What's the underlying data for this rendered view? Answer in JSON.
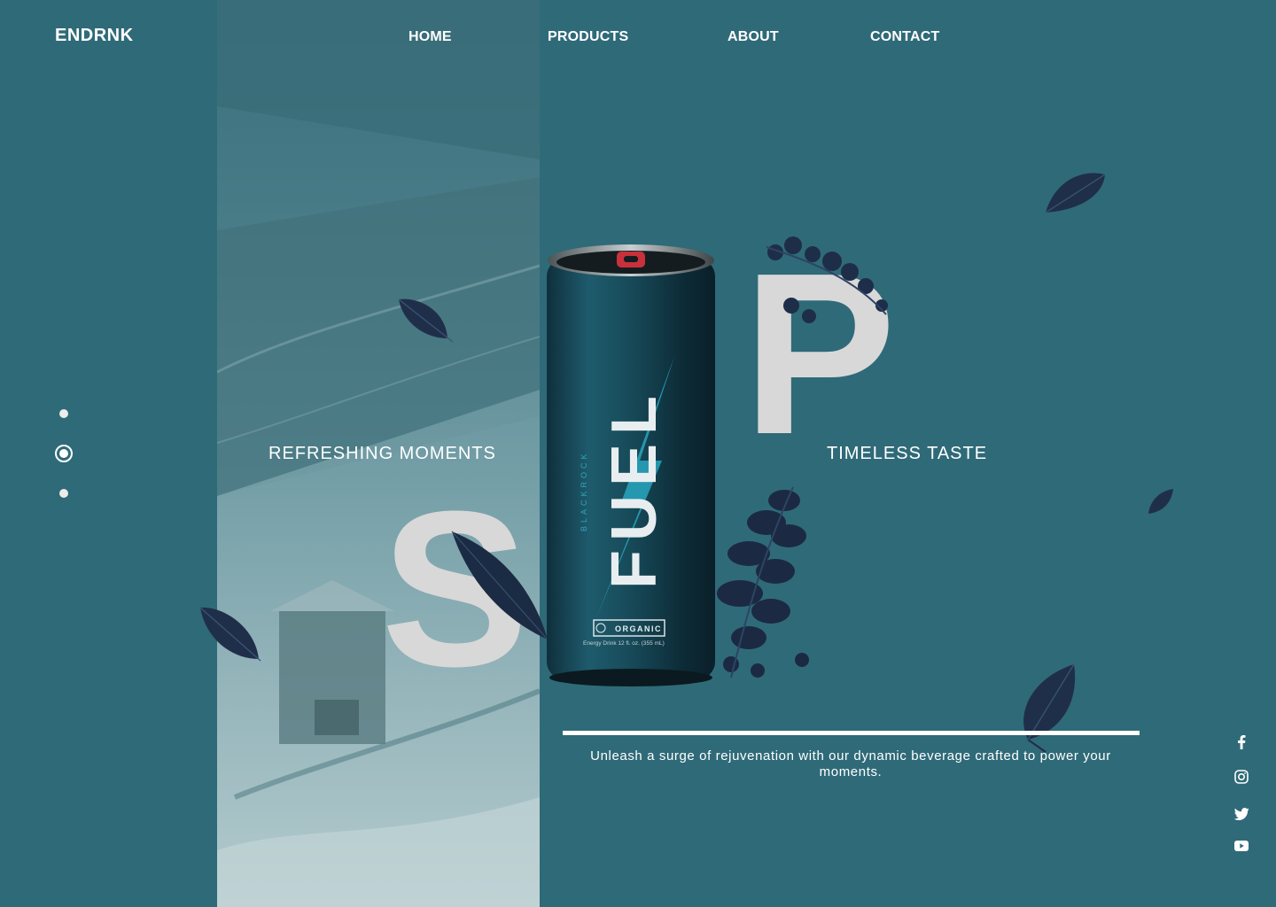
{
  "brand": {
    "logo": "ENDRNK"
  },
  "nav": {
    "items": [
      {
        "label": "HOME"
      },
      {
        "label": "PRODUCTS"
      },
      {
        "label": "ABOUT"
      },
      {
        "label": "CONTACT"
      }
    ]
  },
  "hero": {
    "tag_left": "REFRESHING MOMENTS",
    "tag_right": "TIMELESS TASTE",
    "letter_left": "S",
    "letter_right": "P",
    "can": {
      "brand_text": "FUEL",
      "sub_brand": "BLACKROCK",
      "badge": "ORGANIC",
      "caption": "Energy Drink    12 fl. oz. (355 mL)"
    },
    "description": "Unleash a surge of rejuvenation with our dynamic beverage crafted to power your moments."
  },
  "slider": {
    "count": 3,
    "active_index": 1
  },
  "social": [
    {
      "icon": "facebook-icon"
    },
    {
      "icon": "instagram-icon"
    },
    {
      "icon": "twitter-icon"
    },
    {
      "icon": "youtube-icon"
    }
  ],
  "colors": {
    "background": "#2f6a78",
    "accent": "#ffffff",
    "letter": "#d8d8d8"
  }
}
